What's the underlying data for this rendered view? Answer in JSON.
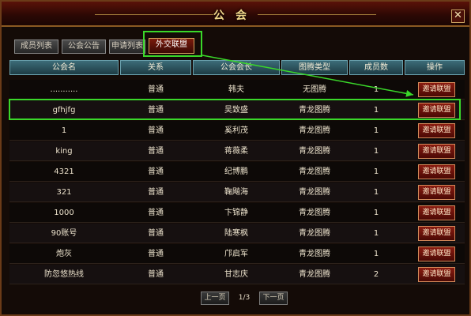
{
  "window": {
    "title": "公会",
    "close_symbol": "✕"
  },
  "tabs": [
    {
      "label": "成员列表"
    },
    {
      "label": "公会公告"
    },
    {
      "label": "申请列表"
    },
    {
      "label": "外交联盟",
      "active": true
    }
  ],
  "columns": [
    "公会名",
    "关系",
    "公会会长",
    "图腾类型",
    "成员数",
    "操作"
  ],
  "rows": [
    {
      "name": "...........",
      "relation": "普通",
      "leader": "韩夫",
      "totem": "无图腾",
      "members": "1",
      "action": "邀请联盟"
    },
    {
      "name": "gfhjfg",
      "relation": "普通",
      "leader": "吴致盛",
      "totem": "青龙图腾",
      "members": "1",
      "action": "邀请联盟"
    },
    {
      "name": "1",
      "relation": "普通",
      "leader": "奚利茂",
      "totem": "青龙图腾",
      "members": "1",
      "action": "邀请联盟"
    },
    {
      "name": "king",
      "relation": "普通",
      "leader": "蒋薇柔",
      "totem": "青龙图腾",
      "members": "1",
      "action": "邀请联盟"
    },
    {
      "name": "4321",
      "relation": "普通",
      "leader": "纪博鹏",
      "totem": "青龙图腾",
      "members": "1",
      "action": "邀请联盟"
    },
    {
      "name": "321",
      "relation": "普通",
      "leader": "鞠飚海",
      "totem": "青龙图腾",
      "members": "1",
      "action": "邀请联盟"
    },
    {
      "name": "1000",
      "relation": "普通",
      "leader": "卞锦静",
      "totem": "青龙图腾",
      "members": "1",
      "action": "邀请联盟"
    },
    {
      "name": "90账号",
      "relation": "普通",
      "leader": "陆寒枫",
      "totem": "青龙图腾",
      "members": "1",
      "action": "邀请联盟"
    },
    {
      "name": "炮灰",
      "relation": "普通",
      "leader": "邝启军",
      "totem": "青龙图腾",
      "members": "1",
      "action": "邀请联盟"
    },
    {
      "name": "防忽悠热线",
      "relation": "普通",
      "leader": "甘志庆",
      "totem": "青龙图腾",
      "members": "2",
      "action": "邀请联盟"
    }
  ],
  "pager": {
    "prev": "上一页",
    "page": "1/3",
    "next": "下一页"
  },
  "colors": {
    "highlight": "#3ad82a",
    "accent_red": "#8a1c10",
    "header_teal": "#3c6c78"
  }
}
